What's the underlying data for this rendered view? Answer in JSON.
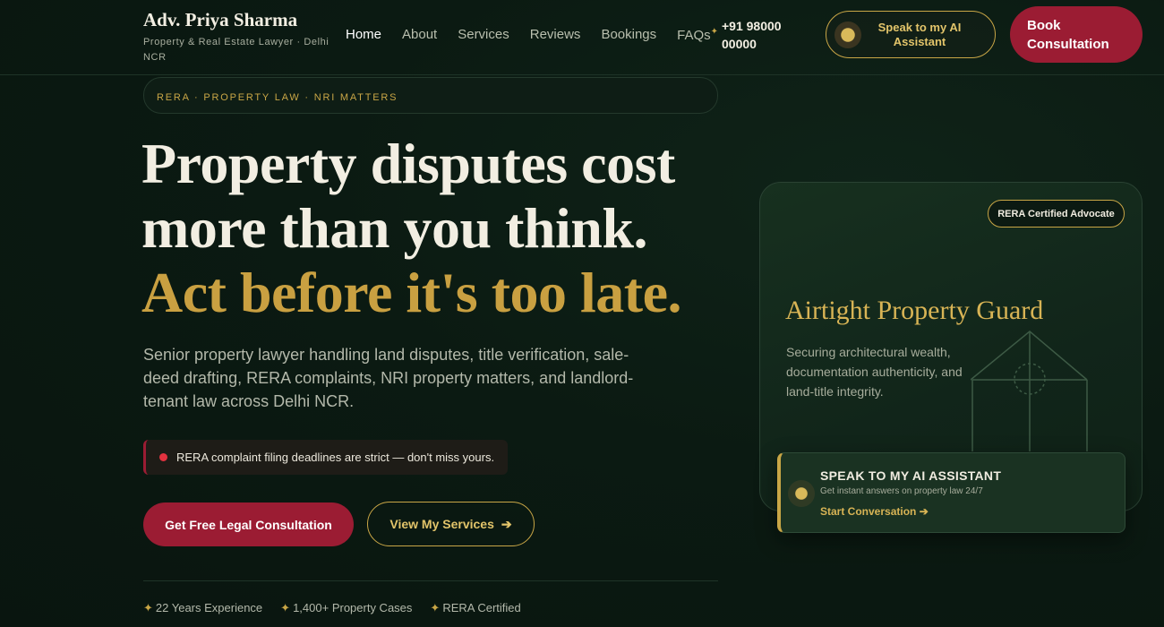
{
  "brand": {
    "name": "Adv. Priya Sharma",
    "tagline": "Property & Real Estate Lawyer · Delhi NCR"
  },
  "nav": {
    "items": [
      "Home",
      "About",
      "Services",
      "Reviews",
      "Bookings",
      "FAQs"
    ],
    "active": "Home"
  },
  "header": {
    "phone": "+91 98000 00000",
    "ai_button": "Speak to my AI Assistant",
    "book_button": "Book Consultation"
  },
  "hero": {
    "eyebrow": "RERA · PROPERTY LAW · NRI MATTERS",
    "headline_line1": "Property disputes cost",
    "headline_line2": "more than you think.",
    "headline_line3": "Act before it's too late.",
    "description": "Senior property lawyer handling land disputes, title verification, sale-deed drafting, RERA complaints, NRI property matters, and landlord-tenant law across Delhi NCR.",
    "alert": "RERA complaint filing deadlines are strict — don't miss yours.",
    "cta_primary": "Get Free Legal Consultation",
    "cta_secondary": "View My Services",
    "cta_secondary_arrow": "➔",
    "stats": [
      "22 Years Experience",
      "1,400+ Property Cases",
      "RERA Certified"
    ]
  },
  "card": {
    "badge": "RERA Certified Advocate",
    "title": "Airtight Property Guard",
    "description": "Securing architectural wealth, documentation authenticity, and land-title integrity."
  },
  "ai_panel": {
    "title": "SPEAK TO MY AI ASSISTANT",
    "subtitle": "Get instant answers on property law 24/7",
    "link": "Start Conversation ➔"
  },
  "colors": {
    "background": "#0b1a12",
    "gold": "#c9a646",
    "crimson": "#9b1c33",
    "alert_red": "#e2323f"
  },
  "icons": {
    "stat_marker": "sparkle-icon",
    "ai_indicator": "orb-icon",
    "card_illustration": "house-icon"
  }
}
